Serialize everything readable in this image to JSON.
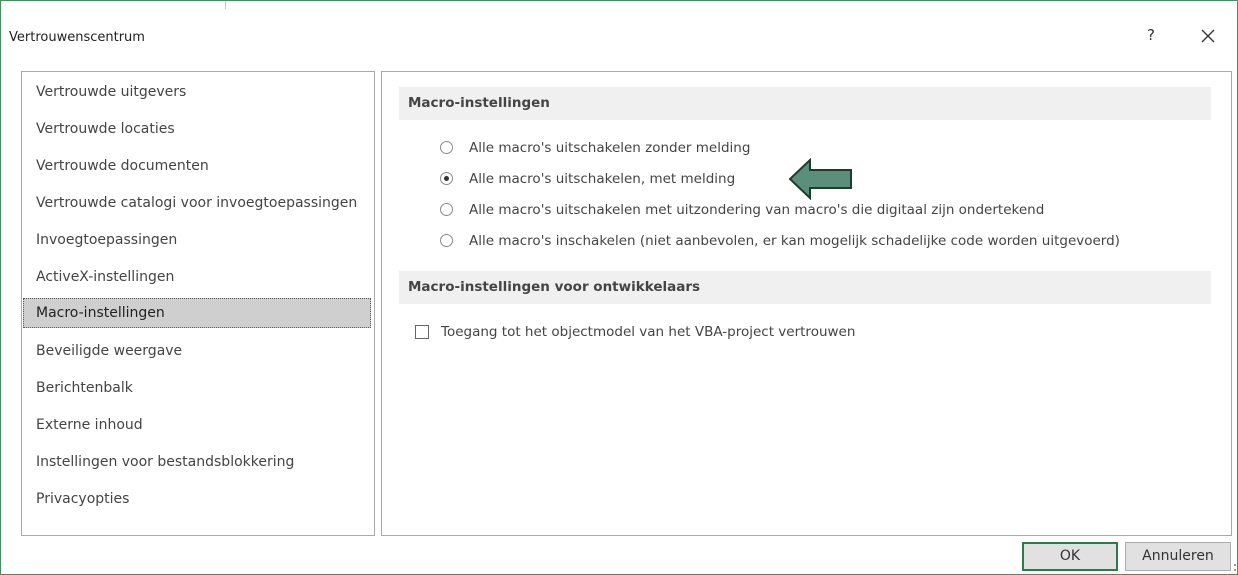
{
  "dialog": {
    "title": "Vertrouwenscentrum",
    "help_label": "?",
    "accent_color": "#2e7a4a"
  },
  "sidebar": {
    "items": [
      {
        "label": "Vertrouwde uitgevers",
        "selected": false
      },
      {
        "label": "Vertrouwde locaties",
        "selected": false
      },
      {
        "label": "Vertrouwde documenten",
        "selected": false
      },
      {
        "label": "Vertrouwde catalogi voor invoegtoepassingen",
        "selected": false
      },
      {
        "label": "Invoegtoepassingen",
        "selected": false
      },
      {
        "label": "ActiveX-instellingen",
        "selected": false
      },
      {
        "label": "Macro-instellingen",
        "selected": true
      },
      {
        "label": "Beveiligde weergave",
        "selected": false
      },
      {
        "label": "Berichtenbalk",
        "selected": false
      },
      {
        "label": "Externe inhoud",
        "selected": false
      },
      {
        "label": "Instellingen voor bestandsblokkering",
        "selected": false
      },
      {
        "label": "Privacyopties",
        "selected": false
      }
    ]
  },
  "macro_settings": {
    "header": "Macro-instellingen",
    "options": [
      {
        "label": "Alle macro's uitschakelen zonder melding",
        "checked": false
      },
      {
        "label": "Alle macro's uitschakelen, met melding",
        "checked": true
      },
      {
        "label": "Alle macro's uitschakelen met uitzondering van macro's die digitaal zijn ondertekend",
        "checked": false
      },
      {
        "label": "Alle macro's inschakelen (niet aanbevolen, er kan mogelijk schadelijke code worden uitgevoerd)",
        "checked": false
      }
    ]
  },
  "developer_settings": {
    "header": "Macro-instellingen voor ontwikkelaars",
    "vba_trust": {
      "label": "Toegang tot het objectmodel van het VBA-project vertrouwen",
      "checked": false
    }
  },
  "annotation": {
    "arrow_icon": "left-arrow-icon",
    "arrow_color": "#5a8f7b"
  },
  "buttons": {
    "ok_label": "OK",
    "cancel_label": "Annuleren"
  }
}
